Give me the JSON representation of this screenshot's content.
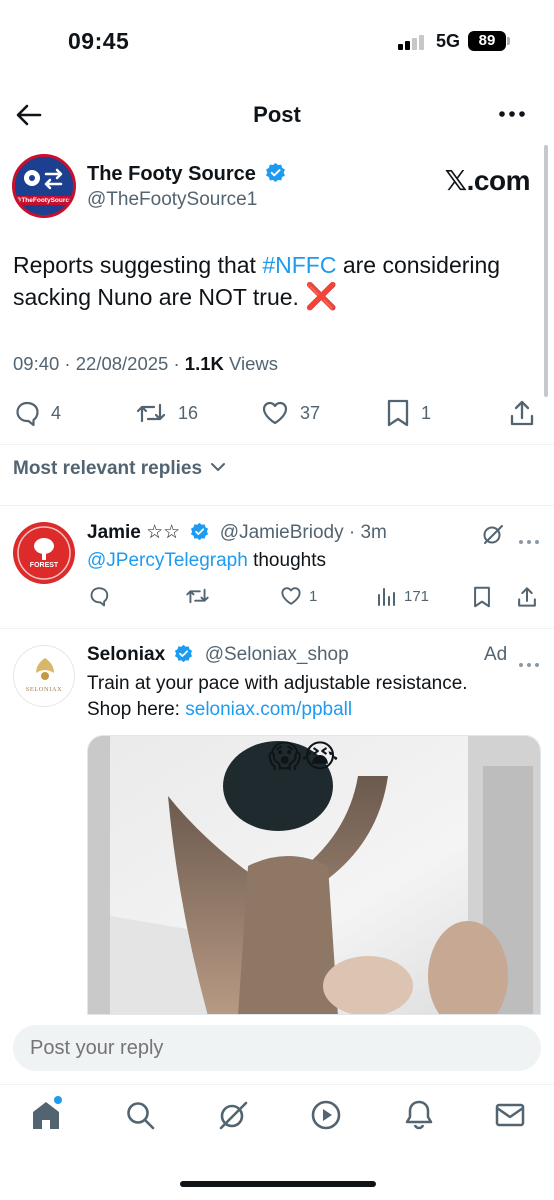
{
  "status_bar": {
    "time": "09:45",
    "network": "5G",
    "battery": "89"
  },
  "header": {
    "title": "Post"
  },
  "post": {
    "author_name": "The Footy Source",
    "author_handle": "@TheFootySource1",
    "avatar_text": "@TheFootySource1",
    "watermark": "𝕏.com",
    "text_before": "Reports suggesting that ",
    "hashtag": "#NFFC",
    "text_after": " are considering sacking Nuno are NOT true. ",
    "emoji": "❌",
    "time": "09:40 · 22/08/2025 · ",
    "views_count": "1.1K",
    "views_label": " Views",
    "replies": "4",
    "reposts": "16",
    "likes": "37",
    "bookmarks": "1"
  },
  "replies_filter": {
    "label": "Most relevant replies"
  },
  "reply1": {
    "name": "Jamie ☆☆",
    "handle": "@JamieBriody · 3m",
    "mention": "@JPercyTelegraph",
    "text": " thoughts",
    "likes": "1",
    "views": "171",
    "avatar_text": "FOREST"
  },
  "ad": {
    "name": "Seloniax",
    "handle": "@Seloniax_shop",
    "ad_label": "Ad",
    "text_line1": "Train at your pace with adjustable resistance.",
    "text_prefix": "Shop here: ",
    "link": "seloniax.com/ppball",
    "avatar_text": "SELONIAX",
    "media_emojis": "😱😭"
  },
  "compose": {
    "placeholder": "Post your reply"
  },
  "colors": {
    "accent": "#1d9bf0",
    "text": "#0f1419",
    "secondary": "#536471",
    "danger": "#e0242b"
  },
  "tabs": [
    "home-icon",
    "search-icon",
    "grok-icon",
    "video-icon",
    "notifications-icon",
    "messages-icon"
  ]
}
